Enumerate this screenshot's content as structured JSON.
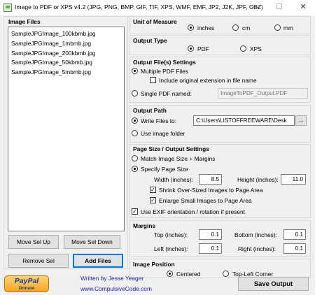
{
  "window": {
    "title": "Image to PDF or XPS  v4.2  (JPG, PNG, BMP, GIF, TIF, XPS, WMF, EMF, JP2, J2K, JPF, CBZ)",
    "minimize": "—",
    "maximize": "☐",
    "close": "✕"
  },
  "image_files": {
    "heading": "Image Files",
    "items": [
      "SampleJPGImage_100kbmb.jpg",
      "SampleJPGImage_1mbmb.jpg",
      "SampleJPGImage_200kbmb.jpg",
      "SampleJPGImage_50kbmb.jpg",
      "SampleJPGImage_5mbmb.jpg"
    ],
    "move_up": "Move Sel Up",
    "move_down": "Move Sel Down",
    "remove": "Remove Sel",
    "add": "Add Files"
  },
  "unit": {
    "heading": "Unit of Measure",
    "options": [
      "inches",
      "cm",
      "mm"
    ],
    "selected": "inches"
  },
  "output_type": {
    "heading": "Output Type",
    "options": [
      "PDF",
      "XPS"
    ],
    "selected": "PDF"
  },
  "output_files": {
    "heading": "Output File(s) Settings",
    "multiple": "Multiple PDF Files",
    "include_ext": "Include original extension in file name",
    "single": "Single PDF named:",
    "single_name": "ImageToPDF_Output.PDF"
  },
  "output_path": {
    "heading": "Output Path",
    "write_files": "Write Files to:",
    "path": "C:\\Users\\LISTOFFREEWARE\\Desk",
    "browse": "...",
    "use_image_folder": "Use image folder"
  },
  "page_size": {
    "heading": "Page Size / Output Settings",
    "match": "Match Image Size + Margins",
    "specify": "Specify Page Size",
    "width_label": "Width (inches):",
    "width": "8.5",
    "height_label": "Height (inches):",
    "height": "11.0",
    "shrink": "Shrink Over-Sized Images to Page Area",
    "enlarge": "Enlarge Small Images to Page Area",
    "exif": "Use EXIF orientation / rotation if present"
  },
  "margins": {
    "heading": "Margins",
    "top_label": "Top (inches):",
    "top": "0.1",
    "bottom_label": "Bottom (inches):",
    "bottom": "0.1",
    "left_label": "Left (inches):",
    "left": "0.1",
    "right_label": "Right (inches):",
    "right": "0.1"
  },
  "image_position": {
    "heading": "Image Position",
    "centered": "Centered",
    "top_left": "Top-Left Corner",
    "selected": "Centered"
  },
  "footer": {
    "paypal": "PayPal",
    "donate": "Donate",
    "written_by": "Written by Jesse Yeager",
    "website": "www.CompulsiveCode.com",
    "save": "Save Output"
  }
}
